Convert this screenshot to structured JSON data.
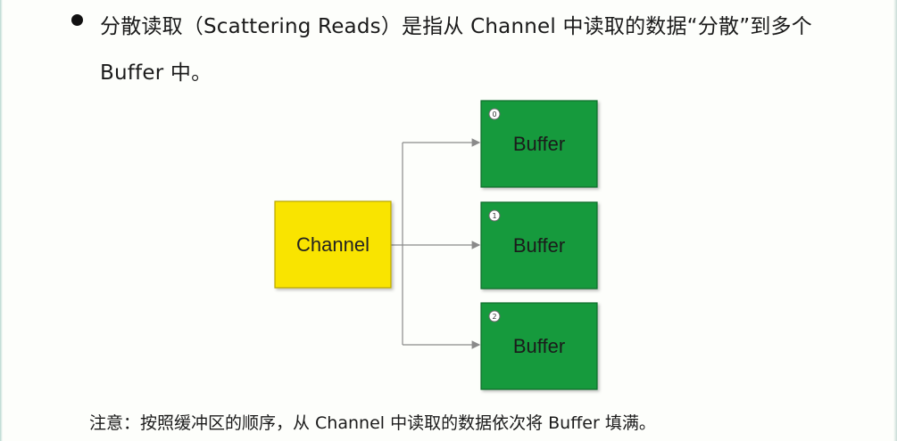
{
  "bullet": {
    "text": "分散读取（Scattering Reads）是指从 Channel 中读取的数据“分散”到多个 Buffer 中。"
  },
  "diagram": {
    "source": {
      "label": "Channel"
    },
    "targets": [
      {
        "label": "Buffer",
        "index": "0"
      },
      {
        "label": "Buffer",
        "index": "1"
      },
      {
        "label": "Buffer",
        "index": "2"
      }
    ],
    "colors": {
      "channel_fill": "#f9e400",
      "channel_stroke": "#b8a600",
      "buffer_fill": "#149a3e",
      "buffer_stroke": "#0c6b2a",
      "arrow": "#8a8a8a"
    }
  },
  "footnote": {
    "text": "注意：按照缓冲区的顺序，从 Channel 中读取的数据依次将 Buffer 填满。"
  }
}
